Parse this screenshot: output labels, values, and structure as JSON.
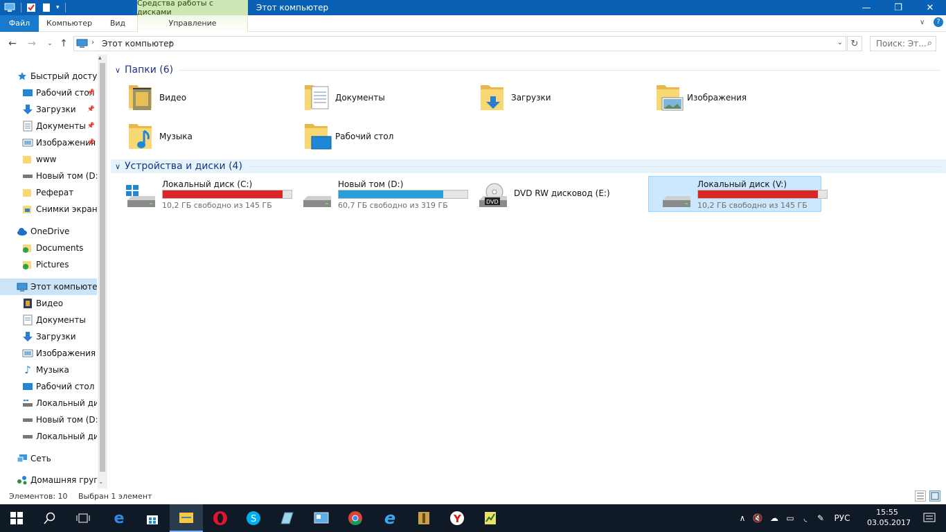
{
  "window": {
    "context_tab": "Средства работы с дисками",
    "title": "Этот компьютер",
    "controls": {
      "minimize": "—",
      "maximize": "❐",
      "close": "✕"
    }
  },
  "ribbon": {
    "tabs": [
      "Файл",
      "Компьютер",
      "Вид",
      "Управление"
    ]
  },
  "address": {
    "crumb": "Этот компьютер",
    "search_placeholder": "Поиск: Эт..."
  },
  "sidebar": {
    "quick_access": "Быстрый доступ",
    "quick_items": [
      "Рабочий стол",
      "Загрузки",
      "Документы",
      "Изображения",
      "www",
      "Новый том (D:)",
      "Реферат",
      "Снимки экрана"
    ],
    "onedrive": "OneDrive",
    "onedrive_items": [
      "Documents",
      "Pictures"
    ],
    "this_pc": "Этот компьютер",
    "pc_items": [
      "Видео",
      "Документы",
      "Загрузки",
      "Изображения",
      "Музыка",
      "Рабочий стол",
      "Локальный диск (C:)",
      "Новый том (D:)",
      "Локальный диск (V:)"
    ],
    "network": "Сеть",
    "homegroup": "Домашняя группа"
  },
  "main": {
    "folders_header": "Папки (6)",
    "folders": [
      "Видео",
      "Документы",
      "Загрузки",
      "Изображения",
      "Музыка",
      "Рабочий стол"
    ],
    "devices_header": "Устройства и диски (4)",
    "drives": [
      {
        "name": "Локальный диск (C:)",
        "free": "10,2 ГБ свободно из 145 ГБ",
        "used_fraction": 0.93,
        "bar_color": "#da2626"
      },
      {
        "name": "Новый том (D:)",
        "free": "60,7 ГБ свободно из 319 ГБ",
        "used_fraction": 0.81,
        "bar_color": "#26a0da"
      },
      {
        "name": "DVD RW дисковод (E:)"
      },
      {
        "name": "Локальный диск (V:)",
        "free": "10,2 ГБ свободно из 145 ГБ",
        "used_fraction": 0.93,
        "bar_color": "#da2626"
      }
    ]
  },
  "status": {
    "items": "Элементов: 10",
    "selected": "Выбран 1 элемент"
  },
  "taskbar": {
    "lang": "РУС",
    "time": "15:55",
    "date": "03.05.2017"
  }
}
